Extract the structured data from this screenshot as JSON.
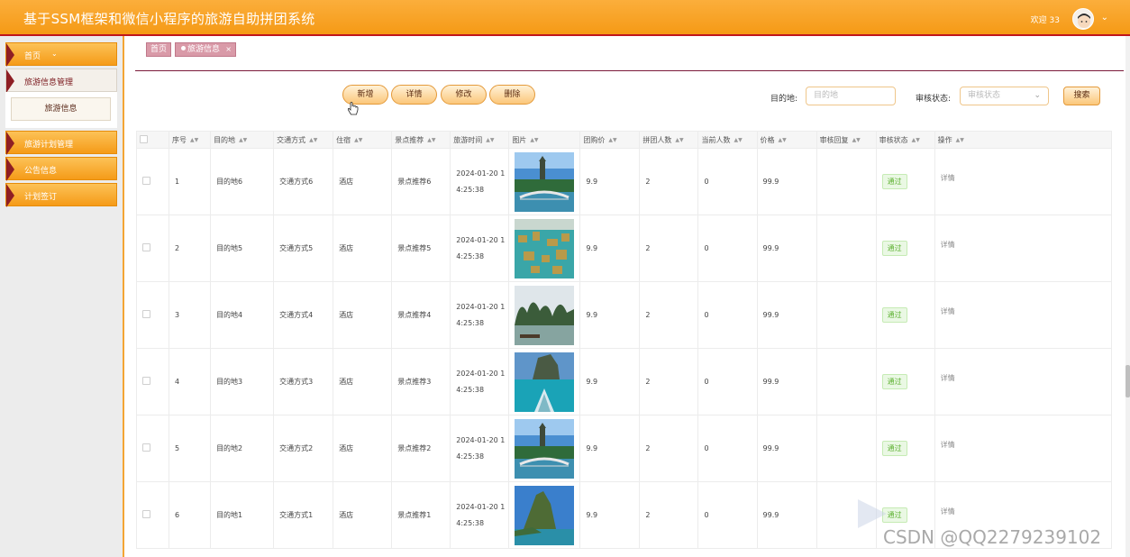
{
  "header": {
    "title": "基于SSM框架和微信小程序的旅游自助拼团系统",
    "welcome": "欢迎 33",
    "user_caret": "⌄"
  },
  "sidebar": {
    "items": [
      {
        "label": "首页",
        "caret": "⌄"
      },
      {
        "label": "旅游信息管理"
      },
      {
        "label": "旅游计划管理"
      },
      {
        "label": "公告信息"
      },
      {
        "label": "计划签订"
      }
    ],
    "submenu": {
      "label": "旅游信息"
    }
  },
  "tabs": {
    "home": "首页",
    "active": "旅游信息",
    "close": "×"
  },
  "toolbar": {
    "add": "新增",
    "detail": "详情",
    "edit": "修改",
    "delete": "删除"
  },
  "search": {
    "dest_label": "目的地:",
    "dest_placeholder": "目的地",
    "status_label": "审核状态:",
    "status_placeholder": "审核状态",
    "status_caret": "⌄",
    "button": "搜索"
  },
  "table": {
    "columns": [
      "序号",
      "目的地",
      "交通方式",
      "住宿",
      "景点推荐",
      "旅游时间",
      "图片",
      "团购价",
      "拼团人数",
      "当前人数",
      "价格",
      "审核回复",
      "审核状态",
      "操作"
    ],
    "sort_glyph": "▲▼",
    "rows": [
      {
        "idx": "1",
        "dest": "目的地6",
        "transport": "交通方式6",
        "stay": "酒店",
        "spot": "景点推荐6",
        "time1": "2024-01-20 1",
        "time2": "4:25:38",
        "group_price": "9.9",
        "group_size": "2",
        "current": "0",
        "price": "99.9",
        "reply": "",
        "status": "通过",
        "op": "详情",
        "image": "bridge"
      },
      {
        "idx": "2",
        "dest": "目的地5",
        "transport": "交通方式5",
        "stay": "酒店",
        "spot": "景点推荐5",
        "time1": "2024-01-20 1",
        "time2": "4:25:38",
        "group_price": "9.9",
        "group_size": "2",
        "current": "0",
        "price": "99.9",
        "reply": "",
        "status": "通过",
        "op": "详情",
        "image": "islands"
      },
      {
        "idx": "3",
        "dest": "目的地4",
        "transport": "交通方式4",
        "stay": "酒店",
        "spot": "景点推荐4",
        "time1": "2024-01-20 1",
        "time2": "4:25:38",
        "group_price": "9.9",
        "group_size": "2",
        "current": "0",
        "price": "99.9",
        "reply": "",
        "status": "通过",
        "op": "详情",
        "image": "karst"
      },
      {
        "idx": "4",
        "dest": "目的地3",
        "transport": "交通方式3",
        "stay": "酒店",
        "spot": "景点推荐3",
        "time1": "2024-01-20 1",
        "time2": "4:25:38",
        "group_price": "9.9",
        "group_size": "2",
        "current": "0",
        "price": "99.9",
        "reply": "",
        "status": "通过",
        "op": "详情",
        "image": "boat"
      },
      {
        "idx": "5",
        "dest": "目的地2",
        "transport": "交通方式2",
        "stay": "酒店",
        "spot": "景点推荐2",
        "time1": "2024-01-20 1",
        "time2": "4:25:38",
        "group_price": "9.9",
        "group_size": "2",
        "current": "0",
        "price": "99.9",
        "reply": "",
        "status": "通过",
        "op": "详情",
        "image": "bridge"
      },
      {
        "idx": "6",
        "dest": "目的地1",
        "transport": "交通方式1",
        "stay": "酒店",
        "spot": "景点推荐1",
        "time1": "2024-01-20 1",
        "time2": "4:25:38",
        "group_price": "9.9",
        "group_size": "2",
        "current": "0",
        "price": "99.9",
        "reply": "",
        "status": "通过",
        "op": "详情",
        "image": "peak"
      }
    ]
  },
  "watermark": "CSDN @QQ2279239102",
  "colors": {
    "header": "#f59a15",
    "accent_dark": "#8e1e24",
    "tab": "#d99aa8",
    "status_green": "#5fb233"
  }
}
